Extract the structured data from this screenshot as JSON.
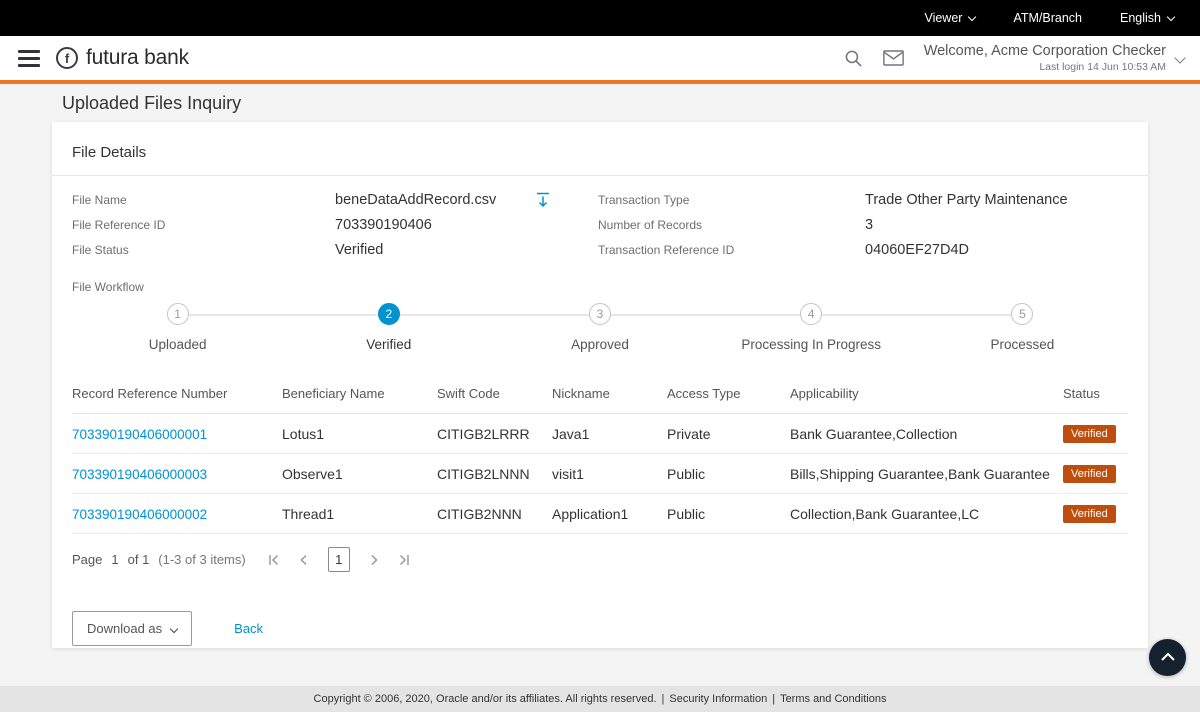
{
  "colors": {
    "accent_orange": "#ED7725",
    "link_blue": "#0092CE",
    "active_step": "#0092CE",
    "badge_bg": "#BE4E0E"
  },
  "topbar": {
    "viewer_label": "Viewer",
    "atm_branch_label": "ATM/Branch",
    "language_label": "English"
  },
  "header": {
    "logo_letter": "f",
    "brand": "futura bank",
    "welcome": "Welcome, Acme Corporation Checker",
    "last_login": "Last login 14 Jun 10:53 AM"
  },
  "page": {
    "title": "Uploaded Files Inquiry"
  },
  "file_details": {
    "section_title": "File Details",
    "fields": [
      {
        "label": "File Name",
        "value": "beneDataAddRecord.csv"
      },
      {
        "label": "File Reference ID",
        "value": "703390190406"
      },
      {
        "label": "File Status",
        "value": "Verified"
      },
      {
        "label": "Transaction Type",
        "value": "Trade Other Party Maintenance"
      },
      {
        "label": "Number of Records",
        "value": "3"
      },
      {
        "label": "Transaction Reference ID",
        "value": "04060EF27D4D"
      }
    ],
    "workflow_label": "File Workflow",
    "workflow_steps": [
      {
        "num": "1",
        "label": "Uploaded"
      },
      {
        "num": "2",
        "label": "Verified"
      },
      {
        "num": "3",
        "label": "Approved"
      },
      {
        "num": "4",
        "label": "Processing In Progress"
      },
      {
        "num": "5",
        "label": "Processed"
      }
    ],
    "active_step": "Verified"
  },
  "records_table": {
    "headers": [
      "Record Reference Number",
      "Beneficiary Name",
      "Swift Code",
      "Nickname",
      "Access Type",
      "Applicability",
      "Status"
    ],
    "rows": [
      {
        "ref": "703390190406000001",
        "beneficiary": "Lotus1",
        "swift": "CITIGB2LRRR",
        "nickname": "Java1",
        "access": "Private",
        "applicability": "Bank Guarantee,Collection",
        "status": "Verified"
      },
      {
        "ref": "703390190406000003",
        "beneficiary": "Observe1",
        "swift": "CITIGB2LNNN",
        "nickname": "visit1",
        "access": "Public",
        "applicability": "Bills,Shipping Guarantee,Bank Guarantee",
        "status": "Verified"
      },
      {
        "ref": "703390190406000002",
        "beneficiary": "Thread1",
        "swift": "CITIGB2NNN",
        "nickname": "Application1",
        "access": "Public",
        "applicability": "Collection,Bank Guarantee,LC",
        "status": "Verified"
      }
    ]
  },
  "pagination": {
    "page_label": "Page",
    "page_number": "1",
    "of_label": "of 1",
    "range_label": "(1-3 of 3 items)",
    "current_page": "1"
  },
  "actions": {
    "download_as_label": "Download as",
    "back_label": "Back"
  },
  "footer": {
    "copyright": "Copyright © 2006, 2020, Oracle and/or its affiliates. All rights reserved.",
    "separator": "|",
    "security_link": "Security Information",
    "terms_link": "Terms and Conditions"
  }
}
